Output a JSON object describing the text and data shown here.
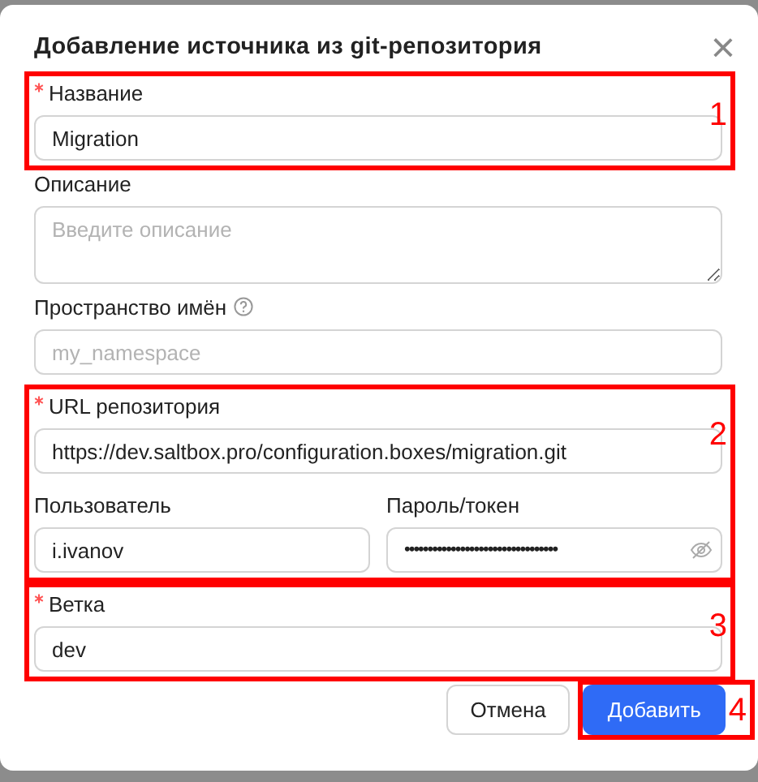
{
  "dialog": {
    "title": "Добавление источника из git-репозитория",
    "close_label": "×"
  },
  "fields": [
    {
      "kind": "input",
      "label": "Название",
      "required": true,
      "value": "Migration",
      "annotation": "1"
    },
    {
      "kind": "textarea",
      "label": "Описание",
      "required": false,
      "placeholder": "Введите описание"
    },
    {
      "kind": "input",
      "label": "Пространство имён",
      "required": false,
      "help": true,
      "placeholder": "my_namespace"
    },
    {
      "kind": "input",
      "label": "URL репозитория",
      "required": true,
      "value": "https://dev.saltbox.pro/configuration.boxes/migration.git",
      "annotation": "2",
      "pair": [
        {
          "kind": "input",
          "label": "Пользователь",
          "value": "i.ivanov"
        },
        {
          "kind": "password",
          "label": "Пароль/токен",
          "value": "•••••••••••••••••••••••••••••••••"
        }
      ]
    },
    {
      "kind": "input",
      "label": "Ветка",
      "required": true,
      "value": "dev",
      "annotation": "3"
    }
  ],
  "buttons": [
    {
      "label": "Отмена",
      "kind": "secondary"
    },
    {
      "label": "Добавить",
      "kind": "primary",
      "annotation": "4"
    }
  ]
}
